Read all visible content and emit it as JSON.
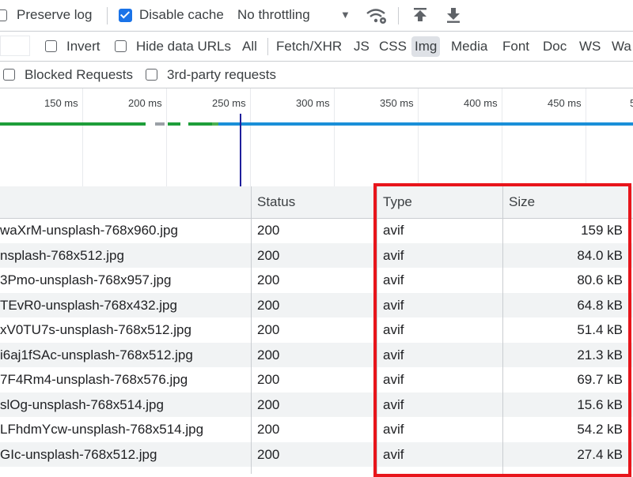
{
  "toolbar": {
    "preserve_log": "Preserve log",
    "disable_cache": "Disable cache",
    "throttling": "No throttling",
    "throttling_arrow": "▼"
  },
  "filters": {
    "invert": "Invert",
    "hide_data_urls": "Hide data URLs",
    "types": [
      "All",
      "Fetch/XHR",
      "JS",
      "CSS",
      "Img",
      "Media",
      "Font",
      "Doc",
      "WS",
      "Wa"
    ],
    "active_type": "Img"
  },
  "requests": {
    "blocked": "Blocked Requests",
    "third_party": "3rd-party requests"
  },
  "timeline": {
    "ticks": [
      "150 ms",
      "200 ms",
      "250 ms",
      "300 ms",
      "350 ms",
      "400 ms",
      "450 ms",
      "5"
    ],
    "colors": {
      "green": "#1e9e3a",
      "gray": "#9aa0a6",
      "blue": "#1a8fd8"
    }
  },
  "table": {
    "headers": {
      "status": "Status",
      "type": "Type",
      "size": "Size"
    },
    "rows": [
      {
        "name": "waXrM-unsplash-768x960.jpg",
        "status": "200",
        "type": "avif",
        "size": "159 kB"
      },
      {
        "name": "nsplash-768x512.jpg",
        "status": "200",
        "type": "avif",
        "size": "84.0 kB"
      },
      {
        "name": "3Pmo-unsplash-768x957.jpg",
        "status": "200",
        "type": "avif",
        "size": "80.6 kB"
      },
      {
        "name": "TEvR0-unsplash-768x432.jpg",
        "status": "200",
        "type": "avif",
        "size": "64.8 kB"
      },
      {
        "name": "xV0TU7s-unsplash-768x512.jpg",
        "status": "200",
        "type": "avif",
        "size": "51.4 kB"
      },
      {
        "name": "i6aj1fSAc-unsplash-768x512.jpg",
        "status": "200",
        "type": "avif",
        "size": "21.3 kB"
      },
      {
        "name": "7F4Rm4-unsplash-768x576.jpg",
        "status": "200",
        "type": "avif",
        "size": "69.7 kB"
      },
      {
        "name": "slOg-unsplash-768x514.jpg",
        "status": "200",
        "type": "avif",
        "size": "15.6 kB"
      },
      {
        "name": "LFhdmYcw-unsplash-768x514.jpg",
        "status": "200",
        "type": "avif",
        "size": "54.2 kB"
      },
      {
        "name": "GIc-unsplash-768x512.jpg",
        "status": "200",
        "type": "avif",
        "size": "27.4 kB"
      }
    ]
  },
  "annotation": {
    "highlight_color": "#e8151b"
  }
}
